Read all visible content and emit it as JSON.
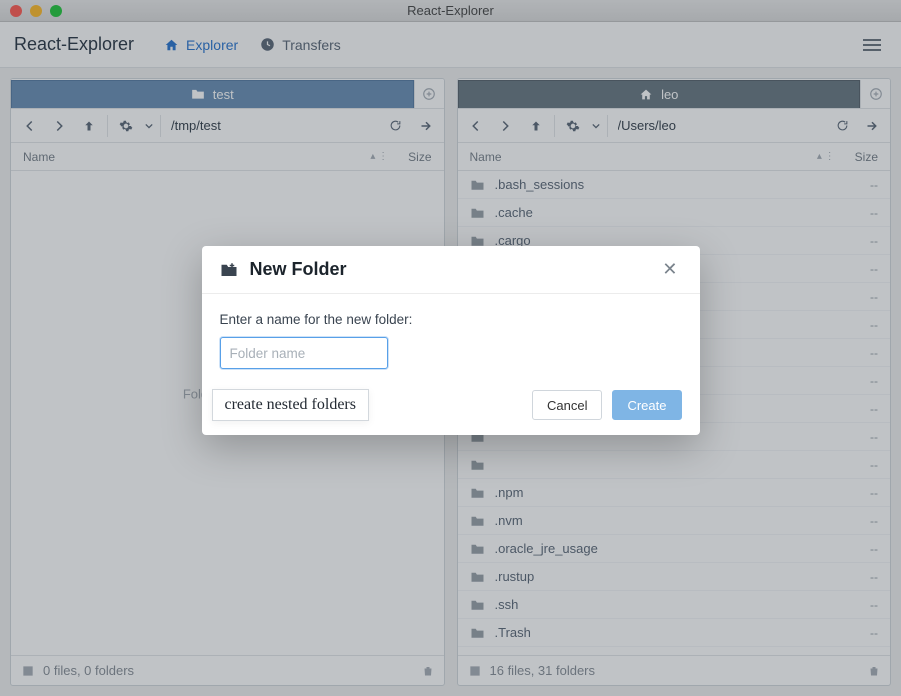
{
  "window": {
    "title": "React-Explorer"
  },
  "toolbar": {
    "appTitle": "React-Explorer",
    "explorerLabel": "Explorer",
    "transfersLabel": "Transfers"
  },
  "leftPane": {
    "tabLabel": "test",
    "path": "/tmp/test",
    "columns": {
      "name": "Name",
      "size": "Size"
    },
    "emptyMessage": "Folder is empty",
    "status": "0 files, 0 folders",
    "files": []
  },
  "rightPane": {
    "tabLabel": "leo",
    "path": "/Users/leo",
    "columns": {
      "name": "Name",
      "size": "Size"
    },
    "status": "16 files, 31 folders",
    "files": [
      {
        "name": ".bash_sessions",
        "size": "--"
      },
      {
        "name": ".cache",
        "size": "--"
      },
      {
        "name": ".cargo",
        "size": "--"
      },
      {
        "name": "",
        "size": "--"
      },
      {
        "name": "",
        "size": "--"
      },
      {
        "name": "",
        "size": "--"
      },
      {
        "name": "",
        "size": "--"
      },
      {
        "name": "",
        "size": "--"
      },
      {
        "name": "",
        "size": "--"
      },
      {
        "name": "",
        "size": "--"
      },
      {
        "name": "",
        "size": "--"
      },
      {
        "name": ".npm",
        "size": "--"
      },
      {
        "name": ".nvm",
        "size": "--"
      },
      {
        "name": ".oracle_jre_usage",
        "size": "--"
      },
      {
        "name": ".rustup",
        "size": "--"
      },
      {
        "name": ".ssh",
        "size": "--"
      },
      {
        "name": ".Trash",
        "size": "--"
      }
    ]
  },
  "modal": {
    "title": "New Folder",
    "label": "Enter a name for the new folder:",
    "placeholder": "Folder name",
    "tooltip": "create nested folders",
    "cancel": "Cancel",
    "create": "Create"
  }
}
